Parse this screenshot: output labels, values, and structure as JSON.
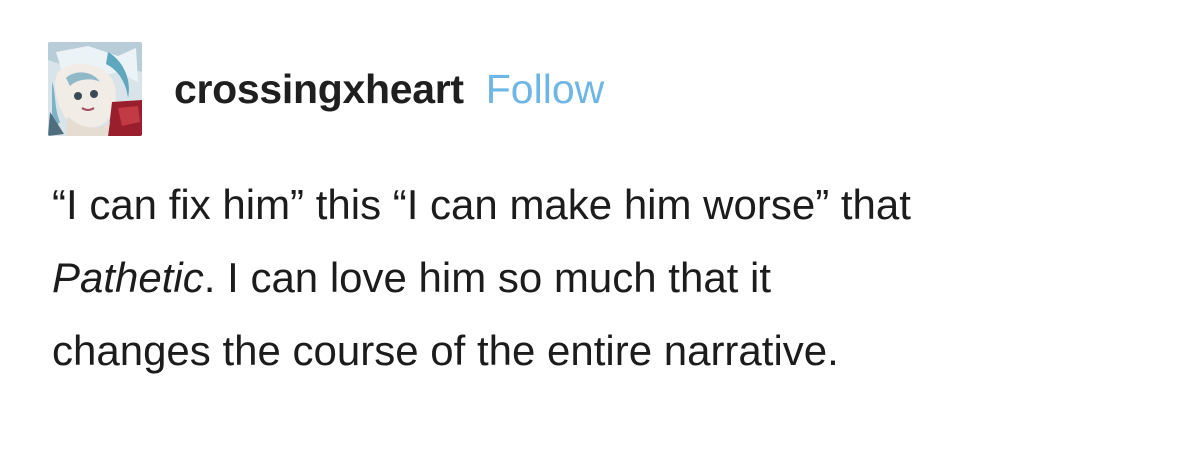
{
  "post": {
    "author": {
      "avatar_icon": "anime-character-avatar",
      "username": "crossingxheart",
      "follow_label": "Follow",
      "follow_color": "#6eb6e6"
    },
    "body": {
      "line1": "“I can fix him” this “I can make him worse” that",
      "line2_italic": "Pathetic",
      "line2_rest": ". I can love him so much that it",
      "line3": "changes the course of the entire narrative."
    }
  }
}
